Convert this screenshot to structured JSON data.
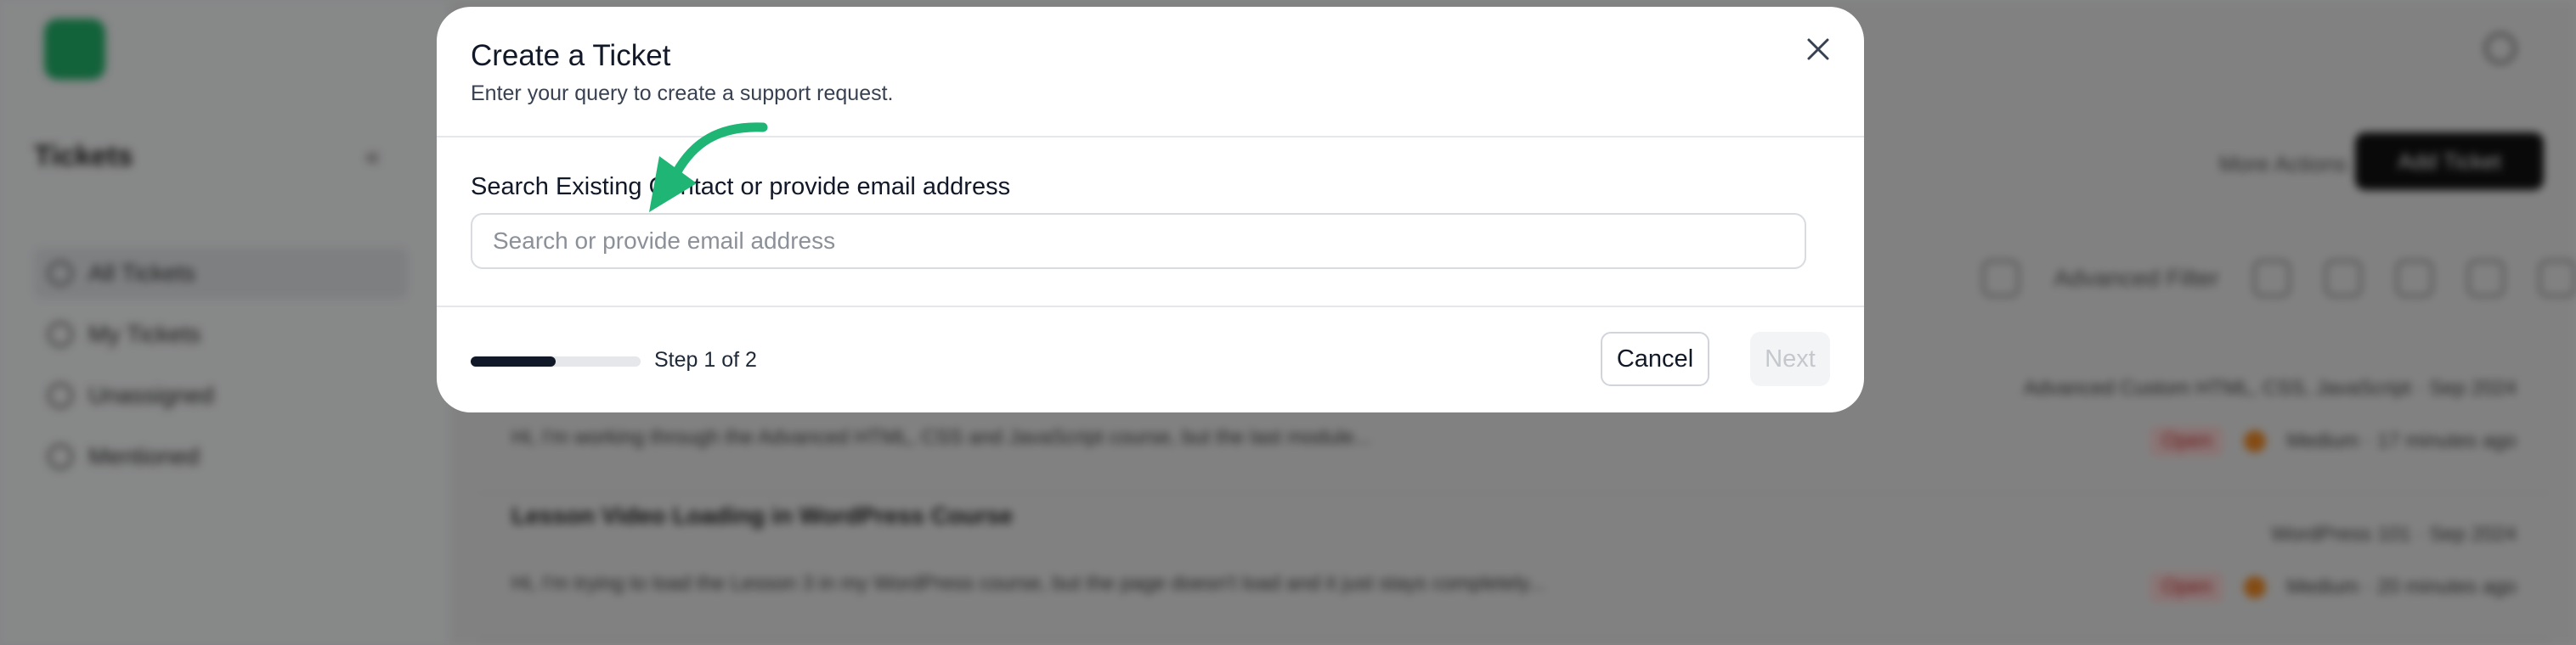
{
  "modal": {
    "title": "Create a Ticket",
    "subtitle": "Enter your query to create a support request.",
    "search_label": "Search Existing Contact or provide email address",
    "search_placeholder": "Search or provide email address",
    "search_value": "",
    "step_text": "Step 1 of 2",
    "progress_fraction": 0.5,
    "cancel_label": "Cancel",
    "next_label": "Next"
  },
  "background": {
    "sidebar": {
      "title": "Tickets",
      "items": [
        {
          "label": "All Tickets"
        },
        {
          "label": "My Tickets"
        },
        {
          "label": "Unassigned"
        },
        {
          "label": "Mentioned"
        }
      ]
    },
    "header": {
      "more_actions_label": "More Actions",
      "add_ticket_label": "Add Ticket"
    },
    "toolbar": {
      "filter_label": "Advanced Filter"
    },
    "tickets": [
      {
        "title": "",
        "meta_right": "Advanced Custom HTML, CSS, JavaScript · Sep 2024",
        "excerpt": "Hi, I'm working through the Advanced HTML, CSS and JavaScript course, but the last module...",
        "badge": "Open",
        "status": "Medium · 17 minutes ago"
      },
      {
        "title": "Lesson Video Loading in WordPress Course",
        "meta_right": "WordPress 101 · Sep 2024",
        "excerpt": "Hi, I'm trying to load the Lesson 3 in my WordPress course, but the page doesn't load and it just stays completely...",
        "badge": "Open",
        "status": "Medium · 20 minutes ago"
      }
    ]
  },
  "colors": {
    "accent_green": "#22b36b",
    "primary_dark": "#111827",
    "overlay": "rgba(0,0,0,0.45)"
  },
  "icons": {
    "close": "close-icon",
    "annotation": "curved-arrow-icon"
  }
}
